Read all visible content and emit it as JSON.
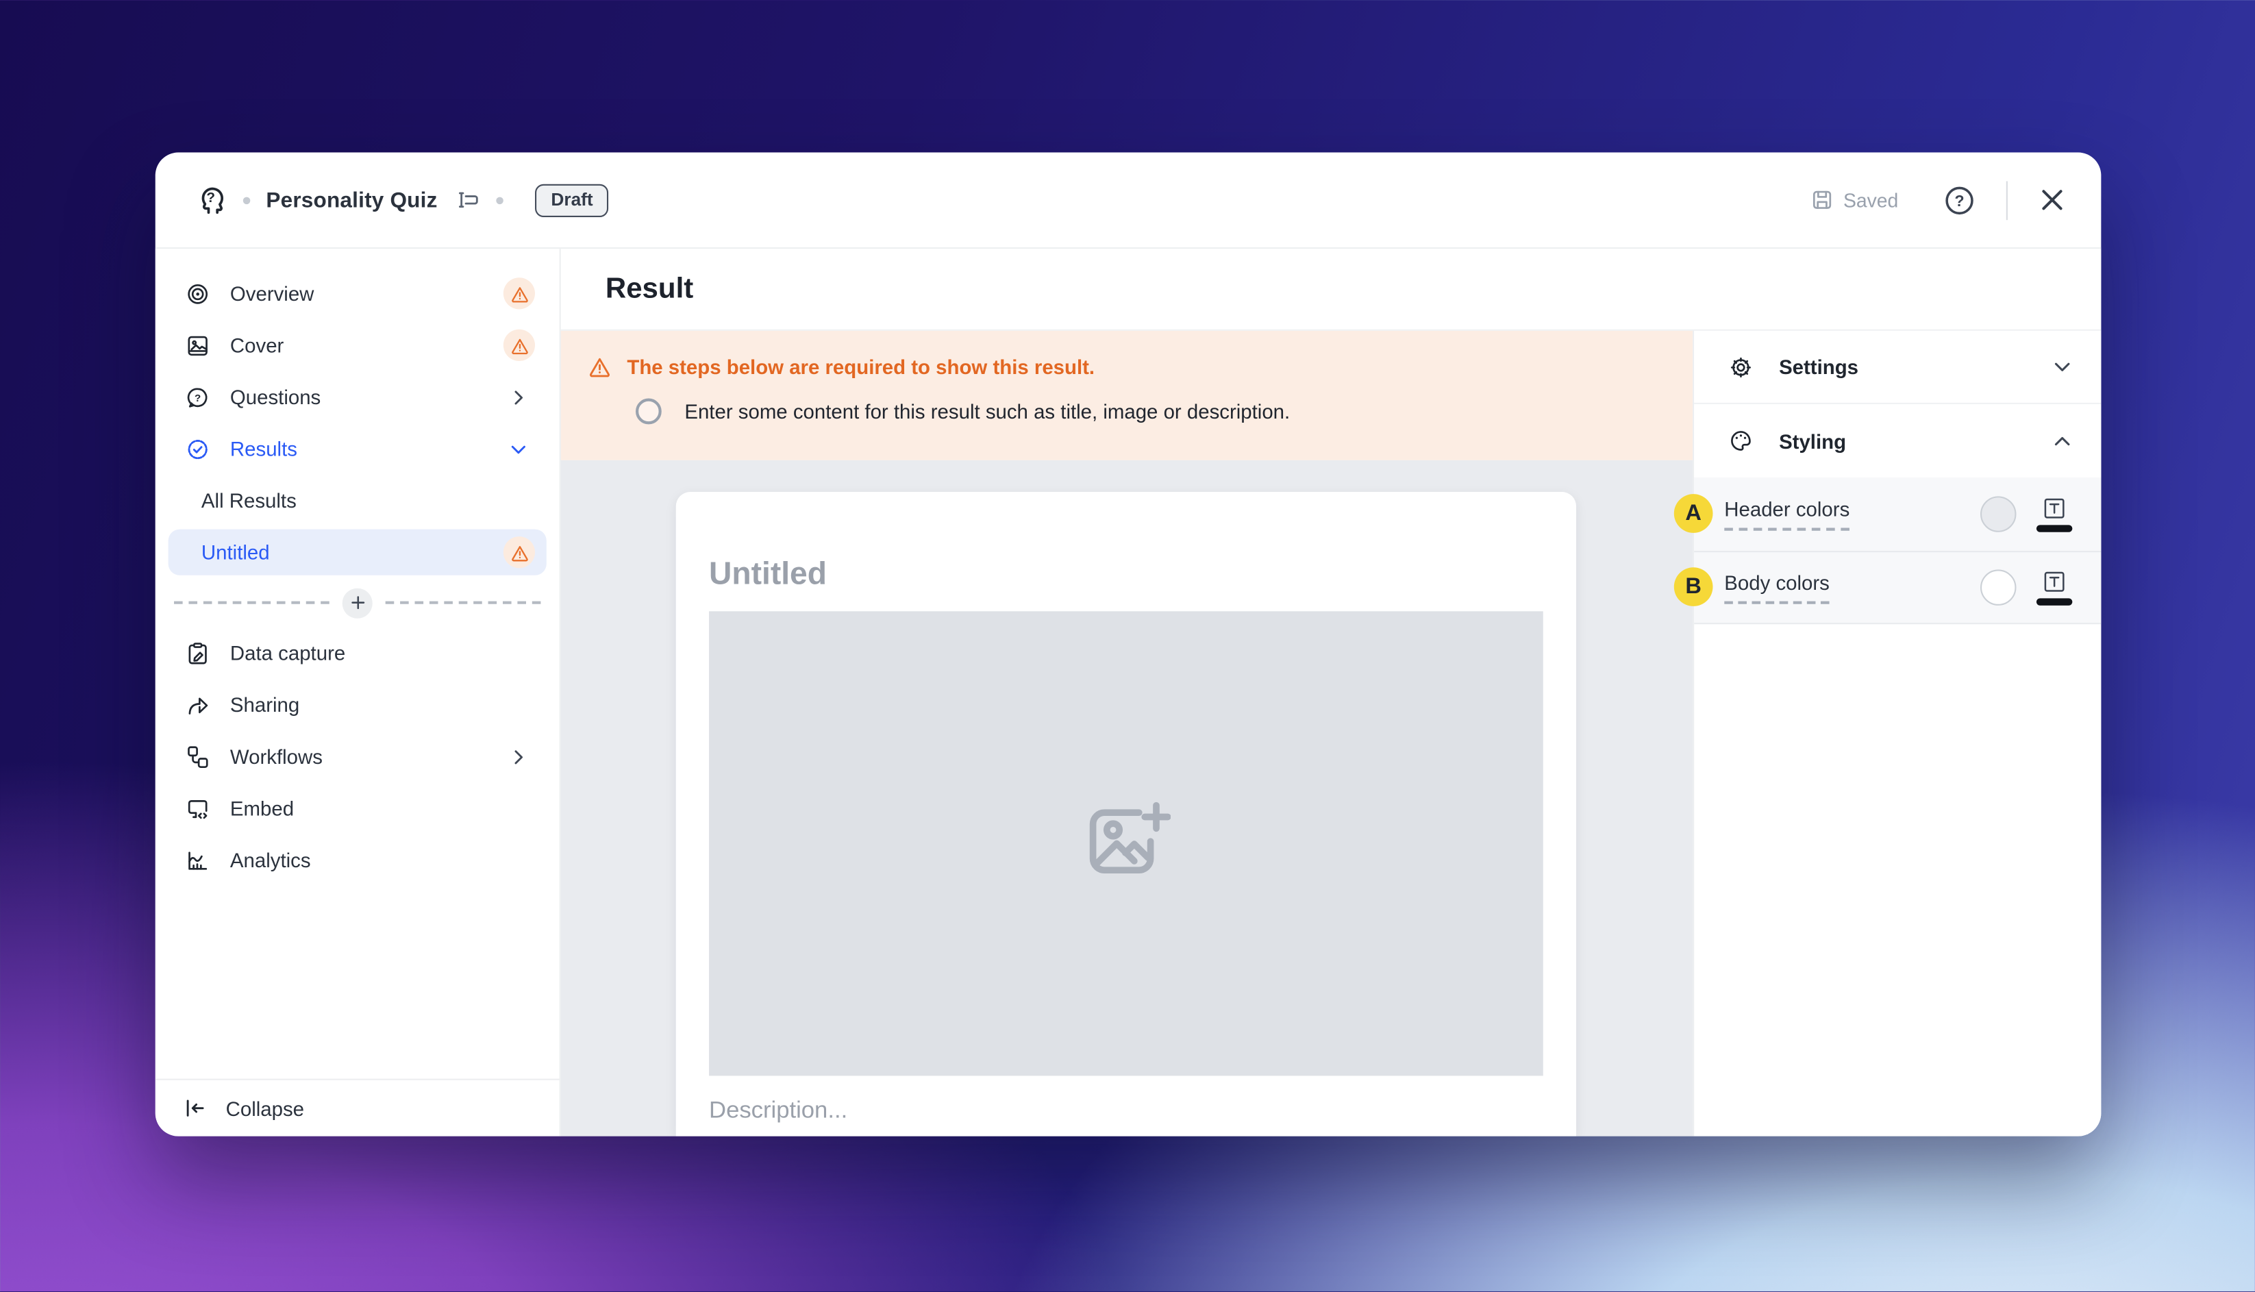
{
  "window": {
    "title": "Personality Quiz",
    "status_badge": "Draft",
    "saved_label": "Saved"
  },
  "sidebar": {
    "items": [
      {
        "label": "Overview",
        "icon": "target-icon",
        "trailing": "warning"
      },
      {
        "label": "Cover",
        "icon": "cover-image-icon",
        "trailing": "warning"
      },
      {
        "label": "Questions",
        "icon": "question-bubble-icon",
        "trailing": "chevron-right"
      },
      {
        "label": "Results",
        "icon": "results-rosette-icon",
        "trailing": "chevron-down",
        "state": "active"
      },
      {
        "label": "All Results",
        "indent": true
      },
      {
        "label": "Untitled",
        "indent": true,
        "state": "selected",
        "trailing": "warning"
      },
      {
        "label": "Data capture",
        "icon": "clipboard-pencil-icon"
      },
      {
        "label": "Sharing",
        "icon": "share-arrow-icon"
      },
      {
        "label": "Workflows",
        "icon": "workflow-nodes-icon",
        "trailing": "chevron-right"
      },
      {
        "label": "Embed",
        "icon": "embed-monitor-icon"
      },
      {
        "label": "Analytics",
        "icon": "analytics-chart-icon"
      }
    ],
    "add_result_button": "+",
    "collapse_label": "Collapse"
  },
  "main": {
    "heading": "Result",
    "banner": {
      "title": "The steps below are required to show this result.",
      "step": "Enter some content for this result such as title, image or description."
    },
    "preview_card": {
      "title_placeholder": "Untitled",
      "description_placeholder": "Description..."
    }
  },
  "panel": {
    "sections": [
      {
        "label": "Settings",
        "state": "collapsed"
      },
      {
        "label": "Styling",
        "state": "expanded"
      }
    ],
    "styling_rows": [
      {
        "badge": "A",
        "label": "Header colors",
        "swatch_color": "#e8eaee",
        "text_color": "#101318"
      },
      {
        "badge": "B",
        "label": "Body colors",
        "swatch_color": "#ffffff",
        "text_color": "#101318"
      }
    ]
  },
  "colors": {
    "accent_blue": "#2a5af5",
    "warning_orange": "#e8702c",
    "banner_bg": "#fcede3",
    "badge_yellow": "#f6d838",
    "selected_item_bg": "#e8eefb"
  }
}
